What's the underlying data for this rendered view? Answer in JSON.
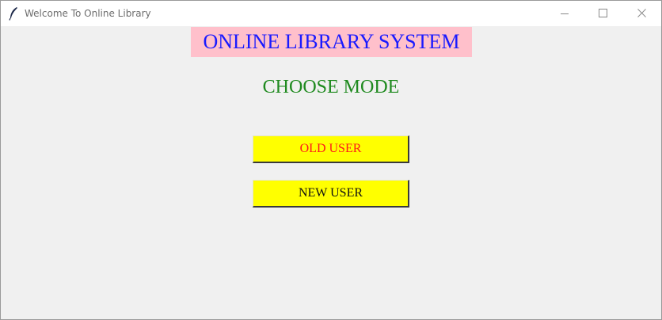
{
  "window": {
    "title": "Welcome To Online Library",
    "icon": "feather-icon",
    "controls": [
      "minimize-icon",
      "maximize-icon",
      "close-icon"
    ]
  },
  "main": {
    "heading": "ONLINE LIBRARY SYSTEM",
    "subheading": "CHOOSE MODE",
    "buttons": {
      "old_user": "OLD USER",
      "new_user": "NEW USER"
    }
  },
  "colors": {
    "heading_text": "#1a1aff",
    "heading_bg": "#ffc0cb",
    "subheading_text": "#1f8a1f",
    "button_bg": "#ffff00",
    "old_user_text": "#ff1a1a",
    "new_user_text": "#111111",
    "client_bg": "#f0f0f0"
  }
}
